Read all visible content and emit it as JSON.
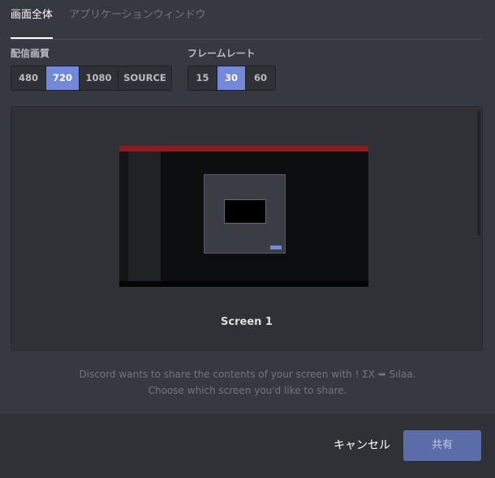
{
  "tabs": {
    "active_label": "画面全体",
    "inactive_label": "アプリケーションウィンドウ"
  },
  "quality": {
    "label": "配信画質",
    "options": [
      "480",
      "720",
      "1080",
      "SOURCE"
    ],
    "selected": "720"
  },
  "framerate": {
    "label": "フレームレート",
    "options": [
      "15",
      "30",
      "60"
    ],
    "selected": "30"
  },
  "preview": {
    "screen_label": "Screen 1"
  },
  "message": {
    "line1": "Discord wants to share the contents of your screen with ! ΣΧ ➥ Sılaa.",
    "line2": "Choose which screen you'd like to share."
  },
  "footer": {
    "cancel_label": "キャンセル",
    "share_label": "共有"
  },
  "colors": {
    "accent": "#7289da",
    "background": "#36393f",
    "footer": "#2f3136"
  }
}
